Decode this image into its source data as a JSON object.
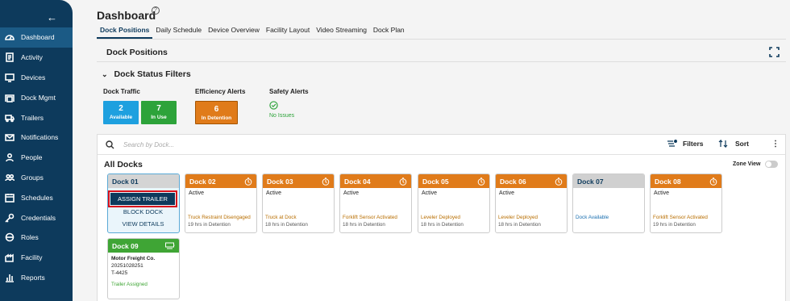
{
  "sidebar": {
    "collapse_icon": "arrow-left-icon",
    "items": [
      {
        "label": "Dashboard",
        "icon": "dashboard-gauge-icon",
        "active": true
      },
      {
        "label": "Activity",
        "icon": "activity-icon"
      },
      {
        "label": "Devices",
        "icon": "devices-icon"
      },
      {
        "label": "Dock Mgmt",
        "icon": "dock-icon"
      },
      {
        "label": "Trailers",
        "icon": "truck-icon"
      },
      {
        "label": "Notifications",
        "icon": "mail-icon"
      },
      {
        "label": "People",
        "icon": "person-icon"
      },
      {
        "label": "Groups",
        "icon": "group-icon"
      },
      {
        "label": "Schedules",
        "icon": "calendar-icon"
      },
      {
        "label": "Credentials",
        "icon": "key-icon"
      },
      {
        "label": "Roles",
        "icon": "roles-icon"
      },
      {
        "label": "Facility",
        "icon": "facility-icon"
      },
      {
        "label": "Reports",
        "icon": "reports-icon"
      }
    ]
  },
  "header": {
    "title": "Dashboard",
    "help": "?",
    "tabs": [
      "Dock Positions",
      "Daily Schedule",
      "Device Overview",
      "Facility Layout",
      "Video Streaming",
      "Dock Plan"
    ]
  },
  "section": {
    "title": "Dock Positions"
  },
  "filters": {
    "title": "Dock Status Filters",
    "dock_traffic": {
      "label": "Dock Traffic",
      "available_count": "2",
      "available_label": "Available",
      "in_use_count": "7",
      "in_use_label": "In Use"
    },
    "efficiency": {
      "label": "Efficiency Alerts",
      "detention_count": "6",
      "detention_label": "In Detention"
    },
    "safety": {
      "label": "Safety Alerts",
      "status": "No Issues"
    }
  },
  "panel": {
    "search_placeholder": "Search by Dock...",
    "filters_label": "Filters",
    "sort_label": "Sort",
    "title": "All Docks",
    "zone_view_label": "Zone View"
  },
  "docks": [
    {
      "name": "Dock 01",
      "menu": [
        "ASSIGN TRAILER",
        "BLOCK DOCK",
        "VIEW DETAILS"
      ]
    },
    {
      "name": "Dock 02",
      "status": "Active",
      "alert": "Truck Restraint Disengaged",
      "sub": "19 hrs in Detention"
    },
    {
      "name": "Dock 03",
      "status": "Active",
      "alert": "Truck at Dock",
      "sub": "18 hrs in Detention"
    },
    {
      "name": "Dock 04",
      "status": "Active",
      "alert": "Forklift Sensor Activated",
      "sub": "18 hrs in Detention"
    },
    {
      "name": "Dock 05",
      "status": "Active",
      "alert": "Leveler Deployed",
      "sub": "18 hrs in Detention"
    },
    {
      "name": "Dock 06",
      "status": "Active",
      "alert": "Leveler Deployed",
      "sub": "18 hrs in Detention"
    },
    {
      "name": "Dock 07",
      "alert": "Dock Available"
    },
    {
      "name": "Dock 08",
      "status": "Active",
      "alert": "Forklift Sensor Activated",
      "sub": "19 hrs in Detention"
    },
    {
      "name": "Dock 09",
      "carrier": "Motor Freight Co.",
      "trailer_id": "20251028251",
      "trailer_no": "T-4425",
      "status": "Trailer Assigned"
    }
  ],
  "colors": {
    "sidebar": "#0d3a5c",
    "available": "#1ea0df",
    "in_use": "#2da33a",
    "detention": "#e07b1a",
    "highlight": "#d8121c"
  }
}
